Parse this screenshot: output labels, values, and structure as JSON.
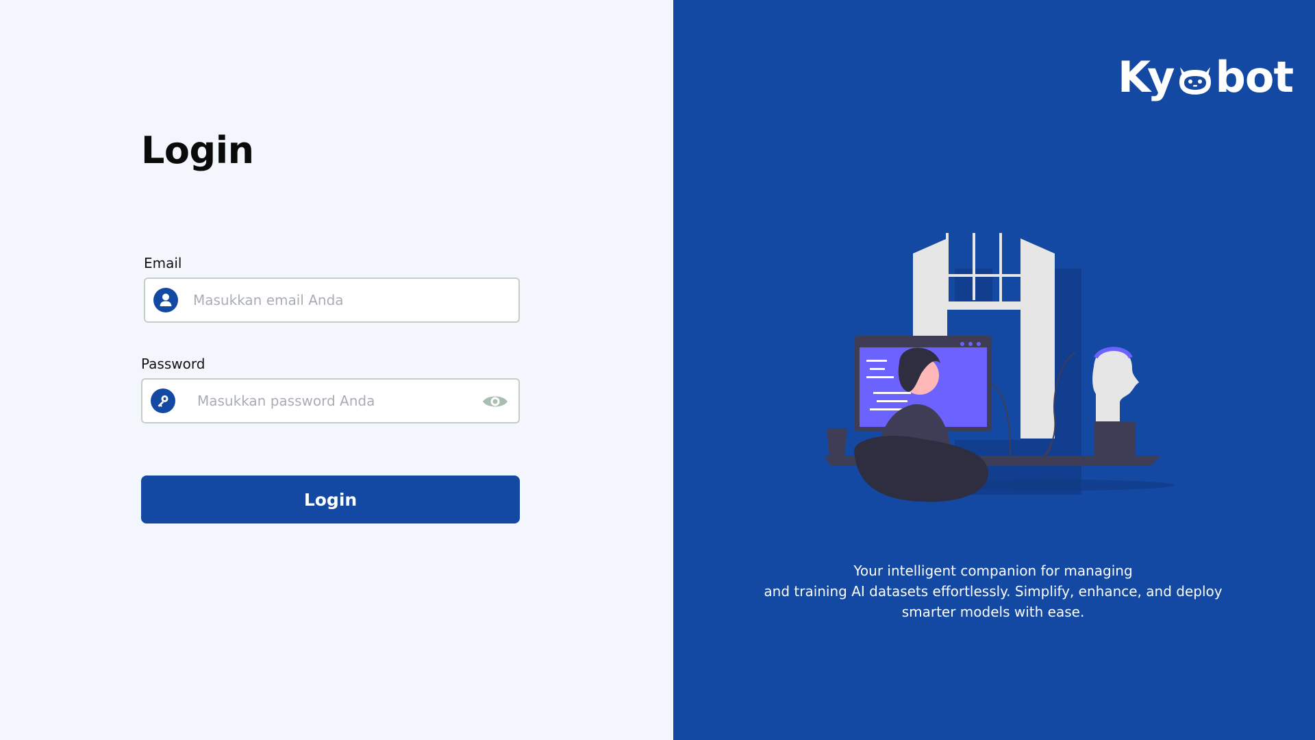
{
  "login": {
    "title": "Login",
    "email_label": "Email",
    "email_placeholder": "Masukkan email Anda",
    "email_value": "",
    "password_label": "Password",
    "password_placeholder": "Masukkan password Anda",
    "password_value": "",
    "submit_label": "Login"
  },
  "brand": {
    "name_prefix": "Ky",
    "name_suffix": "bot",
    "tagline_lines": [
      "Your intelligent companion for managing",
      "and training AI datasets effortlessly. Simplify, enhance, and deploy",
      "smarter models with ease."
    ]
  },
  "icons": {
    "email": "user-icon",
    "password": "key-icon",
    "toggle": "eye-icon",
    "logo": "robot-head-icon"
  },
  "colors": {
    "primary": "#1449a3",
    "background": "#f3f6fd",
    "field_border": "#c3cec7",
    "eye_icon": "#a8bfb0"
  }
}
